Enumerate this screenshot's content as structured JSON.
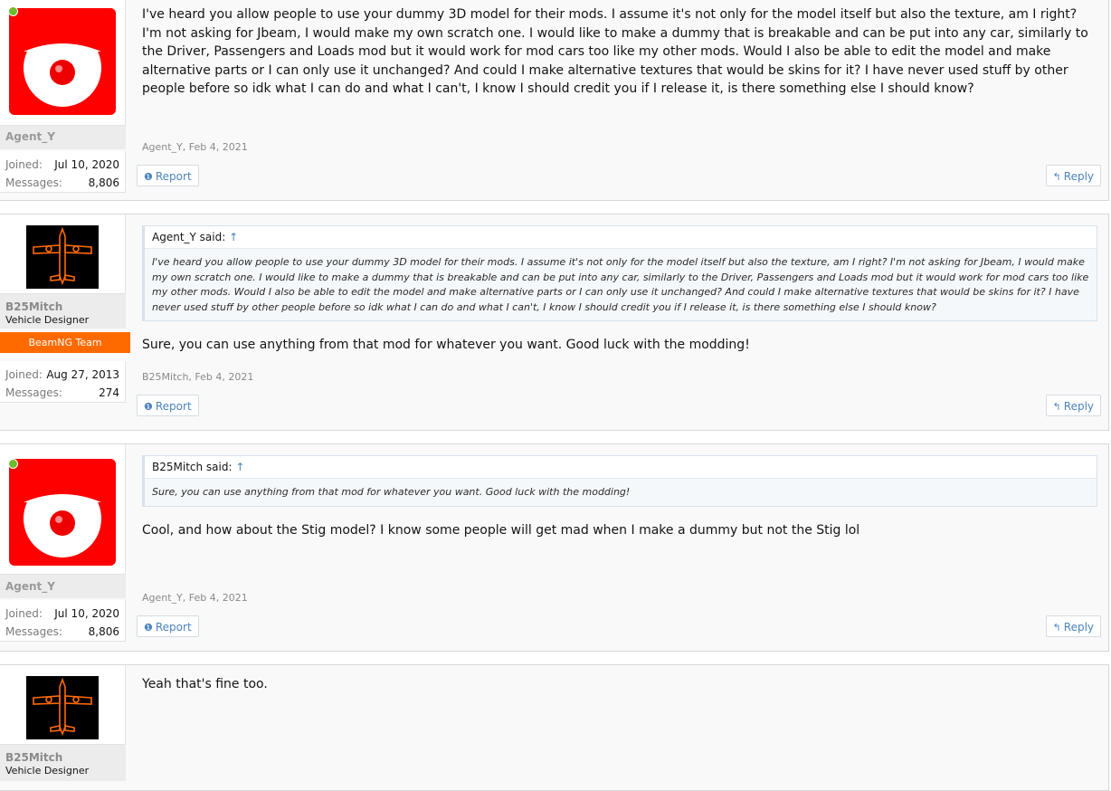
{
  "posts": [
    {
      "author": "Agent_Y",
      "joined_label": "Joined:",
      "joined": "Jul 10, 2020",
      "messages_label": "Messages:",
      "messages": "8,806",
      "message": "I've heard you allow people to use your dummy 3D model for their mods. I assume it's not only for the model itself but also the texture, am I right? I'm not asking for Jbeam, I would make my own scratch one. I would like to make a dummy that is breakable and can be put into any car, similarly to the Driver, Passengers and Loads mod but it would work for mod cars too like my other mods. Would I also be able to edit the model and make alternative parts or I can only use it unchanged? And could I make alternative textures that would be skins for it? I have never used stuff by other people before so idk what I can do and what I can't, I know I should credit you if I release it, is there something else I should know?",
      "meta": "Agent_Y, Feb 4, 2021",
      "report": "Report",
      "reply": "Reply"
    },
    {
      "author": "B25Mitch",
      "user_title": "Vehicle Designer",
      "badge": "BeamNG Team",
      "joined_label": "Joined:",
      "joined": "Aug 27, 2013",
      "messages_label": "Messages:",
      "messages": "274",
      "quote_author": "Agent_Y said:",
      "quote_arrow": "↑",
      "quote": "I've heard you allow people to use your dummy 3D model for their mods. I assume it's not only for the model itself but also the texture, am I right? I'm not asking for Jbeam, I would make my own scratch one. I would like to make a dummy that is breakable and can be put into any car, similarly to the Driver, Passengers and Loads mod but it would work for mod cars too like my other mods. Would I also be able to edit the model and make alternative parts or I can only use it unchanged? And could I make alternative textures that would be skins for it? I have never used stuff by other people before so idk what I can do and what I can't, I know I should credit you if I release it, is there something else I should know?",
      "message": "Sure, you can use anything from that mod for whatever you want. Good luck with the modding!",
      "meta": "B25Mitch, Feb 4, 2021",
      "report": "Report",
      "reply": "Reply"
    },
    {
      "author": "Agent_Y",
      "joined_label": "Joined:",
      "joined": "Jul 10, 2020",
      "messages_label": "Messages:",
      "messages": "8,806",
      "quote_author": "B25Mitch said:",
      "quote_arrow": "↑",
      "quote": "Sure, you can use anything from that mod for whatever you want. Good luck with the modding!",
      "message": "Cool, and how about the Stig model? I know some people will get mad when I make a dummy but not the Stig lol",
      "meta": "Agent_Y, Feb 4, 2021",
      "report": "Report",
      "reply": "Reply"
    },
    {
      "author": "B25Mitch",
      "user_title": "Vehicle Designer",
      "message": "Yeah that's fine too."
    }
  ],
  "icons": {
    "report": "info-circle-icon",
    "reply": "reply-arrow-icon"
  },
  "colors": {
    "accent": "#4a84bd",
    "team_badge": "#ff6a00",
    "online": "#6fbb2e",
    "avatar_red": "#ff0000"
  }
}
